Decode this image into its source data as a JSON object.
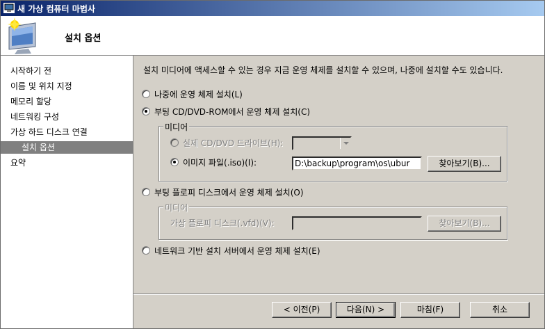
{
  "window": {
    "title": "새 가상 컴퓨터 마법사"
  },
  "header": {
    "title": "설치 옵션"
  },
  "sidebar": {
    "items": [
      {
        "label": "시작하기 전"
      },
      {
        "label": "이름 및 위치 지정"
      },
      {
        "label": "메모리 할당"
      },
      {
        "label": "네트워킹 구성"
      },
      {
        "label": "가상 하드 디스크 연결"
      },
      {
        "label": "설치 옵션"
      },
      {
        "label": "요약"
      }
    ]
  },
  "main": {
    "description": "설치 미디어에 액세스할 수 있는 경우 지금 운영 체제를 설치할 수 있으며, 나중에 설치할 수도 있습니다.",
    "option_later": "나중에 운영 체제 설치(L)",
    "option_cd": "부팅 CD/DVD-ROM에서 운영 체제 설치(C)",
    "cd_group": {
      "legend": "미디어",
      "physical_drive_label": "실제 CD/DVD 드라이브(H):",
      "physical_drive_value": "",
      "image_file_label": "이미지 파일(.iso)(I):",
      "image_file_value": "D:\\backup\\program\\os\\ubur",
      "browse_label": "찾아보기(B)..."
    },
    "option_floppy": "부팅 플로피 디스크에서 운영 체제 설치(O)",
    "floppy_group": {
      "legend": "미디어",
      "vfd_label": "가상 플로피 디스크(.vfd)(V):",
      "vfd_value": "",
      "browse_label": "찾아보기(B)..."
    },
    "option_network": "네트워크 기반 설치 서버에서 운영 체제 설치(E)"
  },
  "footer": {
    "prev_label": "< 이전(P)",
    "next_label": "다음(N) >",
    "finish_label": "마침(F)",
    "cancel_label": "취소"
  },
  "selection": {
    "install_option": "cd",
    "media_source": "image"
  }
}
